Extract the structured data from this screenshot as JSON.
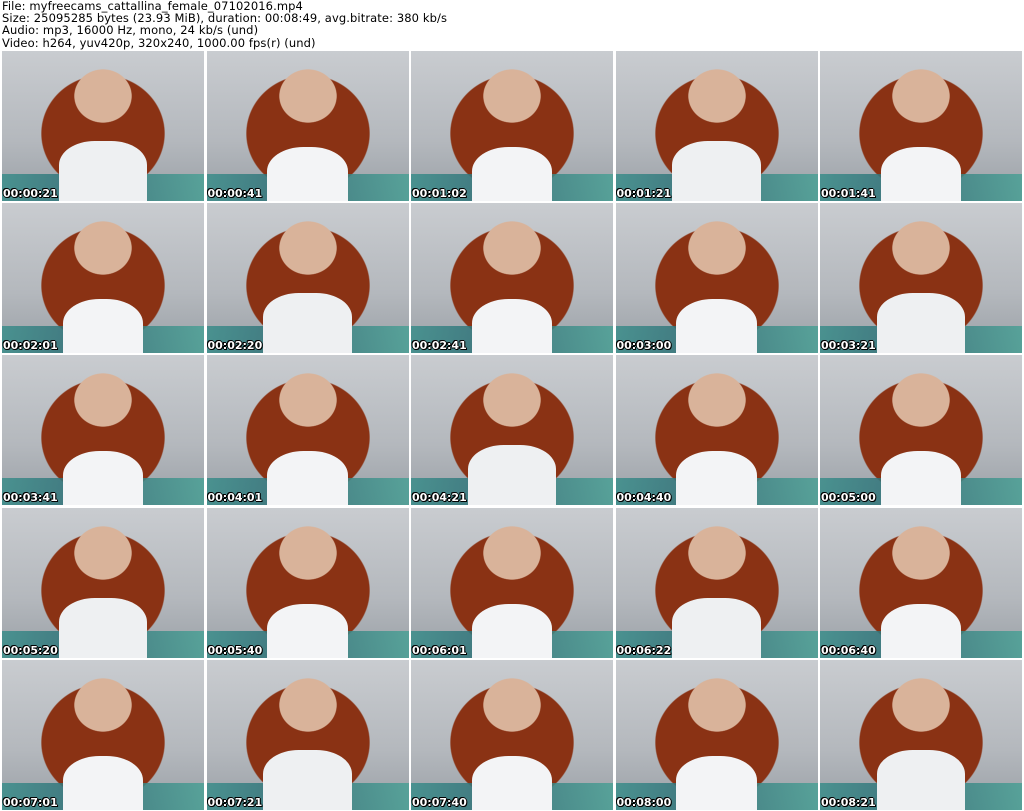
{
  "header": {
    "file": "File: myfreecams_cattallina_female_07102016.mp4",
    "size": "Size: 25095285 bytes (23.93 MiB), duration: 00:08:49, avg.bitrate: 380 kb/s",
    "audio": "Audio: mp3, 16000 Hz, mono, 24 kb/s (und)",
    "video": "Video: h264, yuv420p, 320x240, 1000.00 fps(r) (und)"
  },
  "thumbnails": [
    {
      "timestamp": "00:00:21"
    },
    {
      "timestamp": "00:00:41"
    },
    {
      "timestamp": "00:01:02"
    },
    {
      "timestamp": "00:01:21"
    },
    {
      "timestamp": "00:01:41"
    },
    {
      "timestamp": "00:02:01"
    },
    {
      "timestamp": "00:02:20"
    },
    {
      "timestamp": "00:02:41"
    },
    {
      "timestamp": "00:03:00"
    },
    {
      "timestamp": "00:03:21"
    },
    {
      "timestamp": "00:03:41"
    },
    {
      "timestamp": "00:04:01"
    },
    {
      "timestamp": "00:04:21"
    },
    {
      "timestamp": "00:04:40"
    },
    {
      "timestamp": "00:05:00"
    },
    {
      "timestamp": "00:05:20"
    },
    {
      "timestamp": "00:05:40"
    },
    {
      "timestamp": "00:06:01"
    },
    {
      "timestamp": "00:06:22"
    },
    {
      "timestamp": "00:06:40"
    },
    {
      "timestamp": "00:07:01"
    },
    {
      "timestamp": "00:07:21"
    },
    {
      "timestamp": "00:07:40"
    },
    {
      "timestamp": "00:08:00"
    },
    {
      "timestamp": "00:08:21"
    }
  ]
}
